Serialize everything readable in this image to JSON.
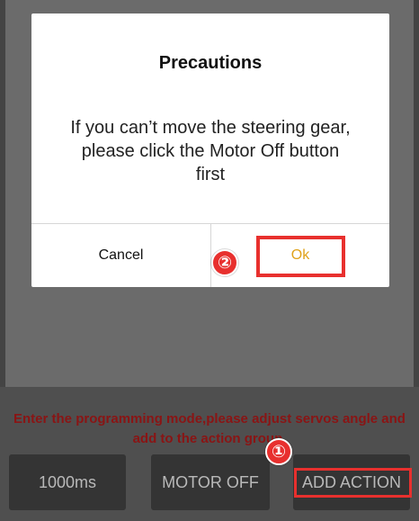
{
  "dialog": {
    "title": "Precautions",
    "message": "If you can’t move the steering gear, please click the Motor Off button first",
    "cancel_label": "Cancel",
    "ok_label": "Ok"
  },
  "panel": {
    "instruction": "Enter the programming mode,please adjust servos angle and add to the action group.",
    "time_label": "1000ms",
    "motor_off_label": "MOTOR OFF",
    "add_action_label": "ADD ACTION"
  },
  "markers": {
    "step1": "①",
    "step2": "②"
  },
  "colors": {
    "highlight": "#e8302e",
    "ok_text": "#e0a21a",
    "instruction_text": "#8a1414",
    "overlay": "#6b6b6b"
  }
}
